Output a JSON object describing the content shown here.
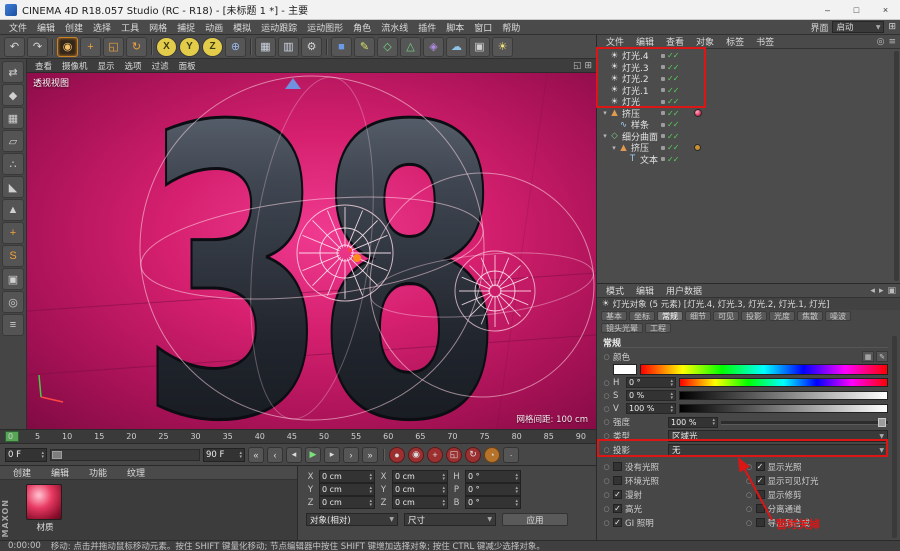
{
  "window": {
    "title": "CINEMA 4D R18.057 Studio (RC - R18) - [未标题 1 *] - 主要",
    "minimize": "–",
    "maximize": "□",
    "close": "×"
  },
  "menubar": {
    "items": [
      "文件",
      "编辑",
      "创建",
      "选择",
      "工具",
      "网格",
      "捕捉",
      "动画",
      "模拟",
      "运动跟踪",
      "运动图形",
      "角色",
      "流水线",
      "插件",
      "脚本",
      "窗口",
      "帮助"
    ],
    "right_label": "界面",
    "layout_value": "启动"
  },
  "toolbar": {
    "buttons": [
      {
        "name": "undo-button",
        "glyph": "↶"
      },
      {
        "name": "redo-button",
        "glyph": "↷"
      },
      {
        "class": "sep"
      },
      {
        "name": "live-selection-button",
        "glyph": "◉",
        "fg": "#f5c06a",
        "class": "active"
      },
      {
        "name": "move-button",
        "glyph": "+",
        "fg": "#f0a23c"
      },
      {
        "name": "scale-button",
        "glyph": "◱",
        "fg": "#f0a23c"
      },
      {
        "name": "rotate-button",
        "glyph": "↻",
        "fg": "#f0a23c"
      },
      {
        "class": "sep"
      },
      {
        "name": "lock-x-axis-button",
        "glyph": "X",
        "class": "round",
        "bg": "#e3cc4a",
        "fg": "#3c3c14"
      },
      {
        "name": "lock-y-axis-button",
        "glyph": "Y",
        "class": "round",
        "bg": "#e3cc4a",
        "fg": "#3c3c14"
      },
      {
        "name": "lock-z-axis-button",
        "glyph": "Z",
        "class": "round",
        "bg": "#e3cc4a",
        "fg": "#3c3c14"
      },
      {
        "name": "coordinate-system-button",
        "glyph": "⊕",
        "fg": "#9ab8e8"
      },
      {
        "class": "sep"
      },
      {
        "name": "render-view-button",
        "glyph": "▦",
        "fg": "#cfd6e2"
      },
      {
        "name": "render-picture-viewer-button",
        "glyph": "▥",
        "fg": "#cfd6e2"
      },
      {
        "name": "render-settings-button",
        "glyph": "⚙",
        "fg": "#d6d6d6"
      },
      {
        "class": "sep"
      },
      {
        "name": "add-cube-button",
        "glyph": "■",
        "fg": "#6b9be8"
      },
      {
        "name": "add-spline-button",
        "glyph": "✎",
        "fg": "#d8e06a"
      },
      {
        "name": "add-subdivision-surface-button",
        "glyph": "◇",
        "fg": "#74d487"
      },
      {
        "name": "add-generator-button",
        "glyph": "△",
        "fg": "#74d487"
      },
      {
        "name": "add-deformer-button",
        "glyph": "◈",
        "fg": "#b08ae0"
      },
      {
        "name": "add-environment-button",
        "glyph": "☁",
        "fg": "#8fc4e8"
      },
      {
        "name": "add-camera-button",
        "glyph": "▣",
        "fg": "#d0d0d0"
      },
      {
        "name": "add-light-button",
        "glyph": "☀",
        "fg": "#f2e27a"
      }
    ]
  },
  "tools_left": {
    "buttons": [
      {
        "name": "make-editable-button",
        "glyph": "⇄"
      },
      {
        "name": "model-mode-button",
        "glyph": "◆"
      },
      {
        "name": "texture-mode-button",
        "glyph": "▦"
      },
      {
        "name": "workplane-mode-button",
        "glyph": "▱"
      },
      {
        "name": "points-mode-button",
        "glyph": "∴"
      },
      {
        "name": "edges-mode-button",
        "glyph": "◣"
      },
      {
        "name": "polygons-mode-button",
        "glyph": "▲"
      },
      {
        "name": "enable-axis-button",
        "glyph": "+",
        "fg": "#f0a23c"
      },
      {
        "name": "enable-snap-button",
        "glyph": "S",
        "fg": "#f0a23c"
      },
      {
        "name": "lock-workplane-button",
        "glyph": "▣"
      },
      {
        "name": "solo-mode-button",
        "glyph": "◎"
      },
      {
        "name": "tool-list-button",
        "glyph": "≡"
      }
    ]
  },
  "viewport": {
    "menu": [
      "查看",
      "摄像机",
      "显示",
      "选项",
      "过滤",
      "面板"
    ],
    "view_label": "透视视图",
    "grid_label": "网格间距: 100 cm",
    "scene_text": "38"
  },
  "timeline": {
    "ticks": [
      "0",
      "5",
      "10",
      "15",
      "20",
      "25",
      "30",
      "35",
      "40",
      "45",
      "50",
      "55",
      "60",
      "65",
      "70",
      "75",
      "80",
      "85",
      "90"
    ],
    "start": "0 F",
    "end": "90 F",
    "buttons": [
      {
        "name": "goto-start-button",
        "glyph": "«"
      },
      {
        "name": "goto-prev-key-button",
        "glyph": "‹"
      },
      {
        "name": "goto-prev-frame-button",
        "glyph": "◂"
      },
      {
        "name": "play-forwards-button",
        "glyph": "▶",
        "class": "play"
      },
      {
        "name": "goto-next-frame-button",
        "glyph": "▸"
      },
      {
        "name": "goto-next-key-button",
        "glyph": "›"
      },
      {
        "name": "goto-end-button",
        "glyph": "»"
      },
      {
        "class": "sep"
      },
      {
        "name": "record-keyframe-button",
        "glyph": "●",
        "class": "rec"
      },
      {
        "name": "autokeying-button",
        "glyph": "◉",
        "class": "rec"
      },
      {
        "name": "record-position-button",
        "glyph": "+",
        "class": "rec"
      },
      {
        "name": "record-scale-button",
        "glyph": "◱",
        "class": "rec"
      },
      {
        "name": "record-rotation-button",
        "glyph": "↻",
        "class": "rec"
      },
      {
        "name": "record-parameter-button",
        "glyph": "◔",
        "class": "rec-o"
      },
      {
        "name": "record-pla-button",
        "glyph": "∙"
      }
    ]
  },
  "materials": {
    "tabs": [
      "创建",
      "编辑",
      "功能",
      "纹理"
    ],
    "name": "材质",
    "brand": "MAXON"
  },
  "coordinates": {
    "rows": [
      {
        "pl": "X",
        "pv": "0 cm",
        "sl": "X",
        "sv": "0 cm",
        "rl": "H",
        "rv": "0 °"
      },
      {
        "pl": "Y",
        "pv": "0 cm",
        "sl": "Y",
        "sv": "0 cm",
        "rl": "P",
        "rv": "0 °"
      },
      {
        "pl": "Z",
        "pv": "0 cm",
        "sl": "Z",
        "sv": "0 cm",
        "rl": "B",
        "rv": "0 °"
      }
    ],
    "mode": "对象(相对)",
    "size": "尺寸",
    "apply": "应用"
  },
  "object_manager": {
    "menu": [
      "文件",
      "编辑",
      "查看",
      "对象",
      "标签",
      "书签"
    ],
    "items": [
      {
        "label": "灯光.4",
        "icon": "light-object-icon",
        "glyph": "☀",
        "fg": "#e6e6e6",
        "badges": "✓✓"
      },
      {
        "label": "灯光.3",
        "icon": "light-object-icon",
        "glyph": "☀",
        "fg": "#e6e6e6",
        "badges": "✓✓"
      },
      {
        "label": "灯光.2",
        "icon": "light-object-icon",
        "glyph": "☀",
        "fg": "#e6e6e6",
        "badges": "✓✓"
      },
      {
        "label": "灯光.1",
        "icon": "light-object-icon",
        "glyph": "☀",
        "fg": "#e6e6e6",
        "badges": "✓✓"
      },
      {
        "label": "灯光",
        "icon": "light-object-icon",
        "glyph": "☀",
        "fg": "#e6e6e6",
        "badges": "✓✓"
      },
      {
        "label": "挤压",
        "icon": "extrude-object-icon",
        "glyph": "▲",
        "fg": "#e09a50",
        "expander": "▾",
        "badges": "✓✓",
        "class": "has-mat"
      },
      {
        "label": "样条",
        "icon": "spline-object-icon",
        "glyph": "∿",
        "fg": "#9ecdf2",
        "indent": 1,
        "badges": "✓✓"
      },
      {
        "label": "细分曲面",
        "icon": "subdivision-surface-object-icon",
        "glyph": "◇",
        "fg": "#7fd08a",
        "expander": "▾",
        "badges": "✓✓"
      },
      {
        "label": "挤压",
        "icon": "extrude-object-icon",
        "glyph": "▲",
        "fg": "#e09a50",
        "indent": 1,
        "expander": "▾",
        "badges": "✓✓",
        "class": "has-tag"
      },
      {
        "label": "文本",
        "icon": "text-object-icon",
        "glyph": "T",
        "fg": "#9ecdf2",
        "indent": 2,
        "badges": "✓✓"
      }
    ]
  },
  "attributes": {
    "menu": [
      "模式",
      "编辑",
      "用户数据"
    ],
    "title": "灯光对象 (5 元素) [灯光.4, 灯光.3, 灯光.2, 灯光.1, 灯光]",
    "tabs_row1": [
      {
        "label": "基本"
      },
      {
        "label": "坐标"
      },
      {
        "label": "常规",
        "class": "active"
      },
      {
        "label": "细节"
      },
      {
        "label": "可见"
      },
      {
        "label": "投影"
      },
      {
        "label": "光度"
      },
      {
        "label": "焦散"
      },
      {
        "label": "噪波"
      }
    ],
    "tabs_row2": [
      {
        "label": "镜头光晕"
      },
      {
        "label": "工程"
      }
    ],
    "section": "常规",
    "color": {
      "label": "颜色",
      "h_label": "H",
      "h_value": "0 °",
      "s_label": "S",
      "s_value": "0 %",
      "v_label": "V",
      "v_value": "100 %"
    },
    "intensity": {
      "label": "强度",
      "value": "100 %"
    },
    "type": {
      "label": "类型",
      "value": "区域光"
    },
    "shadow": {
      "label": "投影",
      "value": "无"
    },
    "checks_left": [
      {
        "label": "没有光照"
      },
      {
        "label": "环境光照"
      },
      {
        "label": "漫射",
        "checked": true
      },
      {
        "label": "高光",
        "checked": true
      },
      {
        "label": "GI 照明",
        "checked": true
      }
    ],
    "checks_right": [
      {
        "label": "显示光照",
        "checked": true
      },
      {
        "label": "显示可见灯光",
        "checked": true
      },
      {
        "label": "显示修剪"
      },
      {
        "label": "分离通道"
      },
      {
        "label": "导出到合成"
      }
    ]
  },
  "annotation": {
    "text": "暂时关掉",
    "color": "#dd1515"
  },
  "status": {
    "time": "0:00:00",
    "message": "移动: 点击并拖动鼠标移动元素。按住 SHIFT 键量化移动; 节点编辑器中按住 SHIFT 键增加选择对象; 按住 CTRL 键减少选择对象。"
  }
}
